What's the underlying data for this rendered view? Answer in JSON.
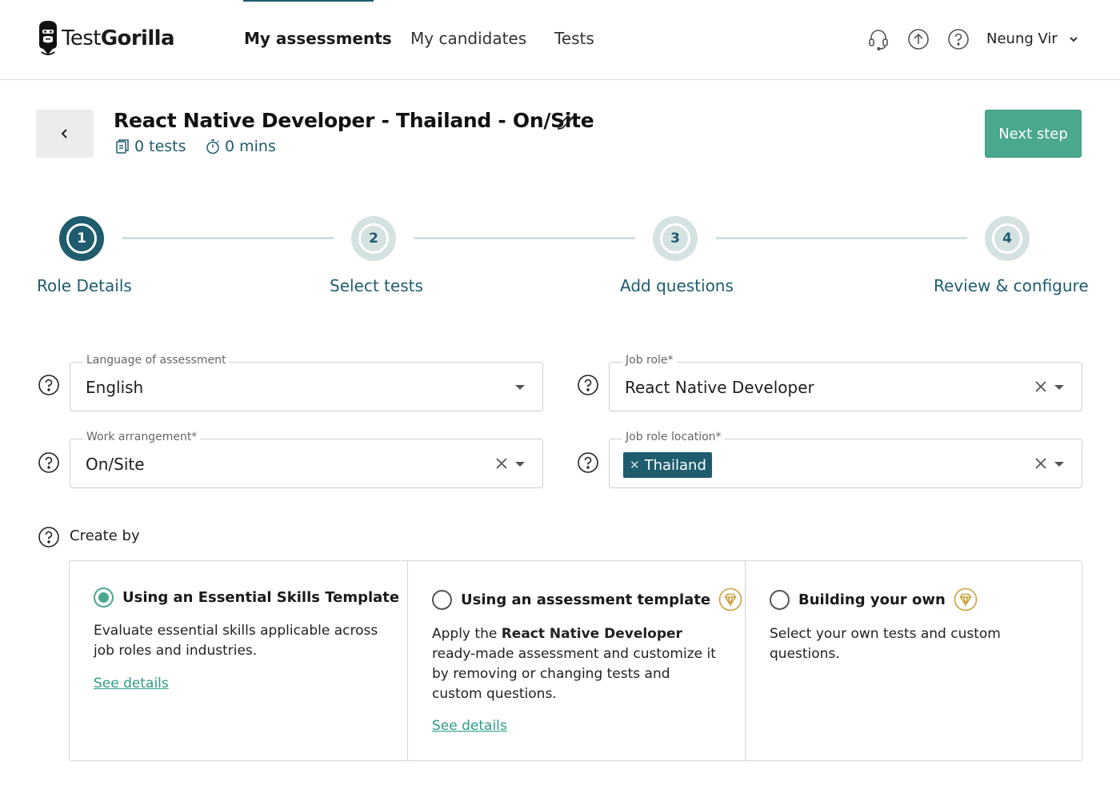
{
  "header": {
    "brand_light": "Test",
    "brand_bold": "Gorilla",
    "nav": [
      {
        "label": "My assessments",
        "active": true
      },
      {
        "label": "My candidates",
        "active": false
      },
      {
        "label": "Tests",
        "active": false
      }
    ],
    "icons": [
      "headset-icon",
      "upload-icon",
      "help-icon"
    ],
    "user_name": "Neung Vir"
  },
  "assessment": {
    "title": "React Native Developer - Thailand - On/Site",
    "tests_count": "0 tests",
    "duration": "0 mins",
    "next_label": "Next step"
  },
  "stepper": {
    "steps": [
      {
        "number": "1",
        "label": "Role Details",
        "active": true
      },
      {
        "number": "2",
        "label": "Select tests",
        "active": false
      },
      {
        "number": "3",
        "label": "Add questions",
        "active": false
      },
      {
        "number": "4",
        "label": "Review & configure",
        "active": false
      }
    ]
  },
  "form": {
    "language": {
      "label": "Language of assessment",
      "value": "English"
    },
    "job_role": {
      "label": "Job role*",
      "value": "React Native Developer"
    },
    "work_arrangement": {
      "label": "Work arrangement*",
      "value": "On/Site"
    },
    "job_location": {
      "label": "Job role location*",
      "chip": "Thailand"
    },
    "create_by_label": "Create by"
  },
  "options": [
    {
      "title": "Using an Essential Skills Template",
      "selected": true,
      "premium": false,
      "description": "Evaluate essential skills applicable across job roles and industries.",
      "link": "See details"
    },
    {
      "title": "Using an assessment template",
      "selected": false,
      "premium": true,
      "desc_before": "Apply the ",
      "desc_bold": "React Native Developer",
      "desc_after": " ready-made assessment and customize it by removing or changing tests and custom questions.",
      "link": "See details"
    },
    {
      "title": "Building your own",
      "selected": false,
      "premium": true,
      "description": "Select your own tests and custom questions."
    }
  ],
  "colors": {
    "primary": "#1e5c6e",
    "accent": "#4aa88f",
    "link": "#2d9b88",
    "premium": "#c9a23c"
  }
}
